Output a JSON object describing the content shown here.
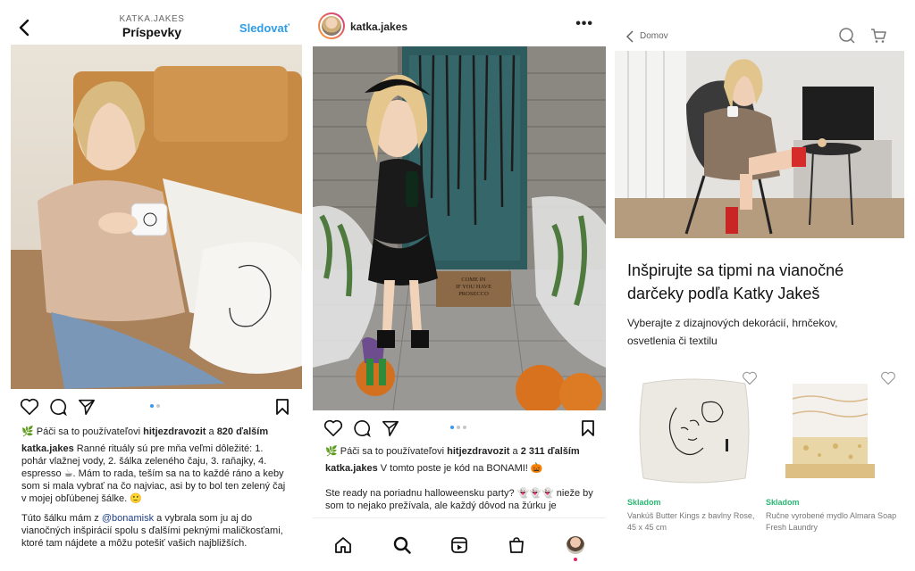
{
  "post1": {
    "username_header": "KATKA.JAKES",
    "title": "Príspevky",
    "follow": "Sledovať",
    "likes_prefix": "Páči sa to používateľovi ",
    "likes_user": "hitjezdravozit",
    "likes_mid": " a ",
    "likes_count": "820 ďalším",
    "caption_user": "katka.jakes",
    "caption_1": " Ranné rituály sú pre mňa veľmi dôležité: 1. pohár vlažnej vody, 2. šálka zeleného čaju, 3. raňajky, 4. espresso ☕. Mám to rada, teším sa na to každé ráno a keby som si mala vybrať na čo najviac, asi by to bol ten zelený čaj v mojej obľúbenej šálke. 🙂",
    "caption_2a": "Túto šálku mám z ",
    "caption_mention": "@bonamisk",
    "caption_2b": " a vybrala som ju aj do vianočných inšpirácií spolu s ďalšími peknými maličkosťami, ktoré tam nájdete a môžu potešiť vašich najbližších."
  },
  "post2": {
    "username": "katka.jakes",
    "more": "•••",
    "doormat": "COME IN\nIF YOU HAVE\nPROSECCO",
    "likes_prefix": "Páči sa to používateľovi ",
    "likes_user": "hitjezdravozit",
    "likes_mid": " a ",
    "likes_count": "2 311 ďalším",
    "caption_user": "katka.jakes",
    "caption_1": " V tomto poste je kód na BONAMI! 🎃",
    "caption_2": "Ste ready na poriadnu halloweensku party? 👻👻👻 niežе by som to nejako prežívala, ale každý dôvod na žúrku je"
  },
  "shop": {
    "breadcrumb": "Domov",
    "heading": "Inšpirujte sa tipmi na vianočné darčeky podľa Katky Jakeš",
    "sub": "Vyberajte z dizajnových dekorácií, hrnčekov, osvetlenia či textilu",
    "products": [
      {
        "stock": "Skladom",
        "name": "Vankúš Butter Kings z bavlny Rose, 45 x 45 cm"
      },
      {
        "stock": "Skladom",
        "name": "Ručne vyrobené mydlo Almara Soap Fresh Laundry"
      }
    ]
  },
  "colors": {
    "link": "#2f9ce8",
    "stock": "#2bb673",
    "dot_active": "#3897f0"
  }
}
